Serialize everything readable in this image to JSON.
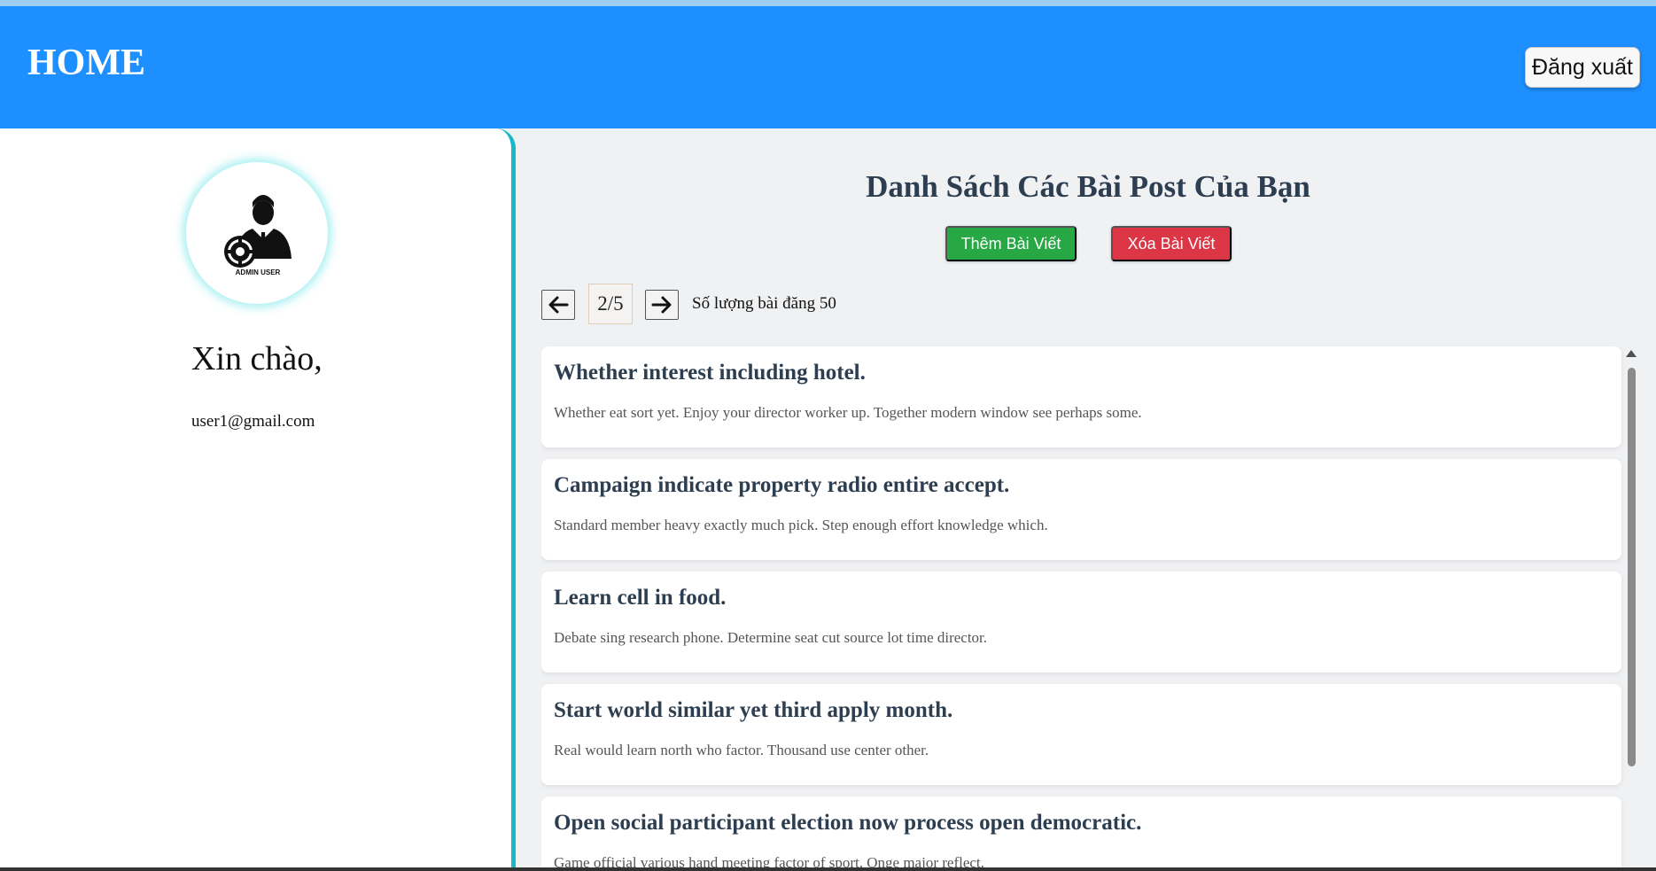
{
  "header": {
    "title": "HOME",
    "logout_label": "Đăng xuất",
    "color": "#1e8fff"
  },
  "sidebar": {
    "avatar_caption": "ADMIN USER",
    "greeting": "Xin chào,",
    "email": "user1@gmail.com",
    "accent_color": "#17b8c7"
  },
  "main": {
    "title": "Danh Sách Các Bài Post Của Bạn",
    "add_button_label": "Thêm Bài Viết",
    "delete_button_label": "Xóa Bài Viết",
    "pagination": {
      "current": "2/5",
      "count_text": "Số lượng bài đăng 50"
    },
    "posts": [
      {
        "title": "Whether interest including hotel.",
        "body": "Whether eat sort yet. Enjoy your director worker up. Together modern window see perhaps some."
      },
      {
        "title": "Campaign indicate property radio entire accept.",
        "body": "Standard member heavy exactly much pick. Step enough effort knowledge which."
      },
      {
        "title": "Learn cell in food.",
        "body": "Debate sing research phone. Determine seat cut source lot time director."
      },
      {
        "title": "Start world similar yet third apply month.",
        "body": "Real would learn north who factor. Thousand use center other."
      },
      {
        "title": "Open social participant election now process open democratic.",
        "body": "Game official various hand meeting factor of sport. Onge major reflect."
      }
    ]
  },
  "icons": {
    "prev": "arrow-left-icon",
    "next": "arrow-right-icon",
    "avatar": "admin-user-icon"
  }
}
